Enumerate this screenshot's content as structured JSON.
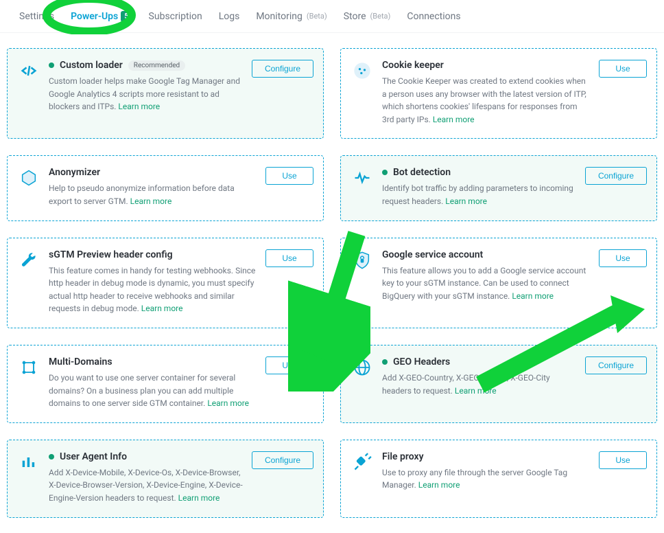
{
  "tabs": {
    "items": [
      {
        "label": "Settings",
        "active": false
      },
      {
        "label": "Power-Ups",
        "active": true,
        "badge": "5"
      },
      {
        "label": "Subscription",
        "active": false
      },
      {
        "label": "Logs",
        "active": false
      },
      {
        "label": "Monitoring",
        "active": false,
        "beta": "(Beta)"
      },
      {
        "label": "Store",
        "active": false,
        "beta": "(Beta)"
      },
      {
        "label": "Connections",
        "active": false
      }
    ]
  },
  "buttons": {
    "use": "Use",
    "configure": "Configure"
  },
  "common": {
    "learn_more": "Learn more",
    "recommended": "Recommended"
  },
  "cards": {
    "custom_loader": {
      "title": "Custom loader",
      "desc": "Custom loader helps make Google Tag Manager and Google Analytics 4 scripts more resistant to ad blockers and ITPs."
    },
    "cookie_keeper": {
      "title": "Cookie keeper",
      "desc": "The Cookie Keeper was created to extend cookies when a person uses any browser with the latest version of ITP, which shortens cookies' lifespans for responses from 3rd party IPs."
    },
    "anonymizer": {
      "title": "Anonymizer",
      "desc": "Help to pseudo anonymize information before data export to server GTM."
    },
    "bot_detection": {
      "title": "Bot detection",
      "desc": "Identify bot traffic by adding parameters to incoming request headers."
    },
    "sgtm_preview": {
      "title": "sGTM Preview header config",
      "desc": "This feature comes in handy for testing webhooks. Since http header in debug mode is dynamic, you must specify actual http header to receive webhooks and similar requests in debug mode."
    },
    "google_service": {
      "title": "Google service account",
      "desc": "This feature allows you to add a Google service account key to your sGTM instance. Can be used to connect BigQuery with your sGTM instance."
    },
    "multi_domains": {
      "title": "Multi-Domains",
      "desc": "Do you want to use one server container for several domains? On a business plan you can add multiple domains to one server side GTM container."
    },
    "geo_headers": {
      "title": "GEO Headers",
      "desc": "Add X-GEO-Country, X-GEO-Region, X-GEO-City headers to request."
    },
    "user_agent": {
      "title": "User Agent Info",
      "desc": "Add X-Device-Mobile, X-Device-Os, X-Device-Browser, X-Device-Browser-Version, X-Device-Engine, X-Device-Engine-Version headers to request."
    },
    "file_proxy": {
      "title": "File proxy",
      "desc": "Use to proxy any file through the server Google Tag Manager."
    }
  }
}
